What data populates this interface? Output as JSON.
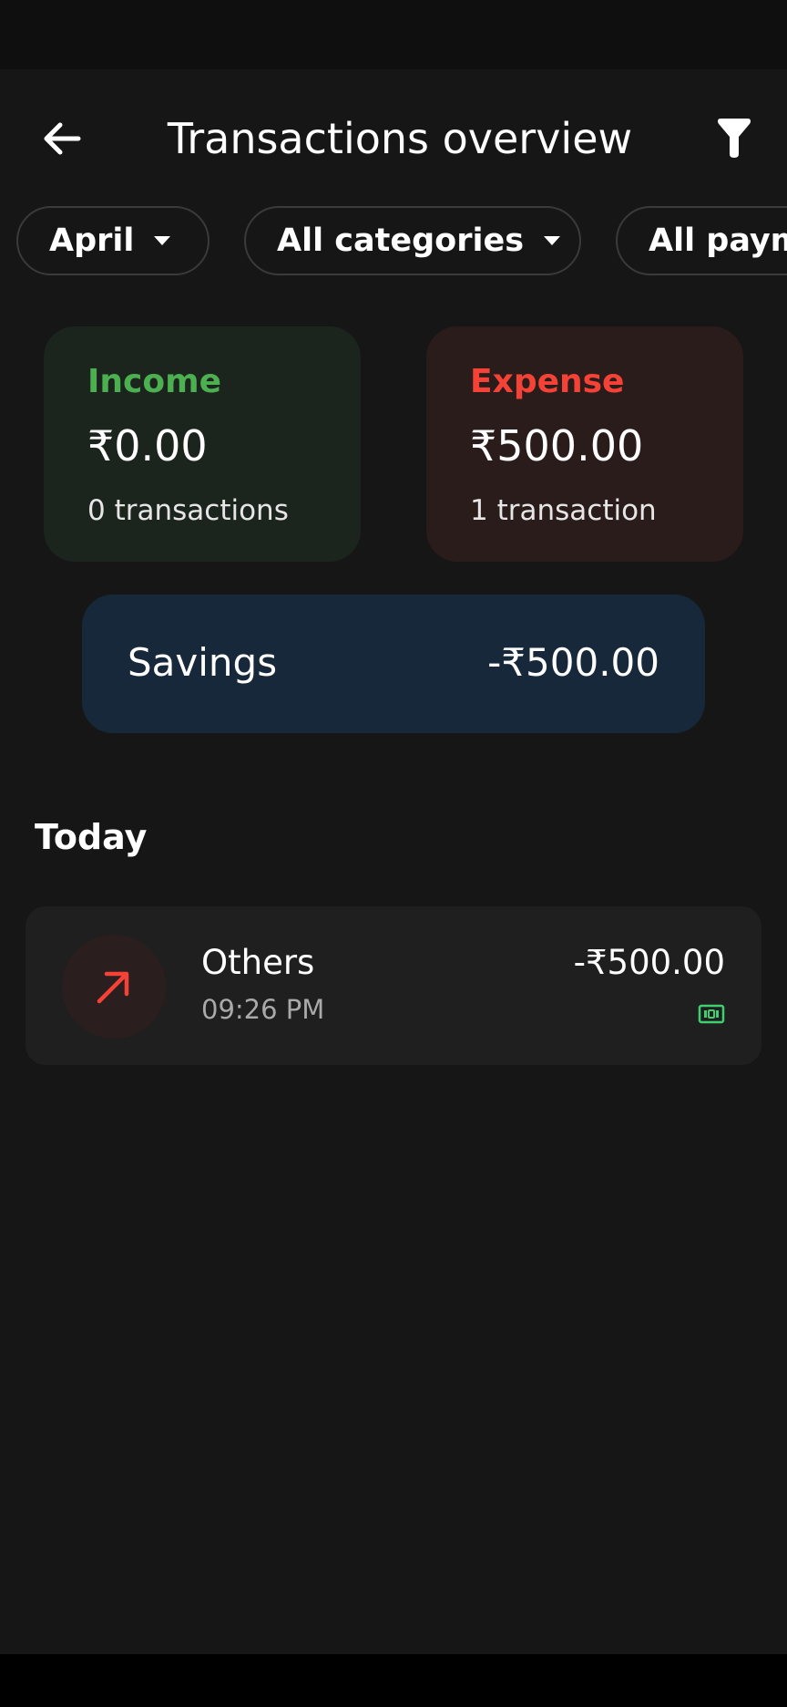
{
  "header": {
    "title": "Transactions overview"
  },
  "filters": [
    {
      "label": "April"
    },
    {
      "label": "All categories"
    },
    {
      "label": "All paym"
    }
  ],
  "income": {
    "label": "Income",
    "amount": "₹0.00",
    "count": "0 transactions",
    "color": "#4caf50"
  },
  "expense": {
    "label": "Expense",
    "amount": "₹500.00",
    "count": "1 transaction",
    "color": "#f44336"
  },
  "savings": {
    "label": "Savings",
    "amount": "-₹500.00"
  },
  "section": {
    "title": "Today"
  },
  "transactions": [
    {
      "category": "Others",
      "time": "09:26 PM",
      "amount": "-₹500.00",
      "direction_icon": "arrow-up-right-icon",
      "payment_icon": "cash-icon"
    }
  ]
}
